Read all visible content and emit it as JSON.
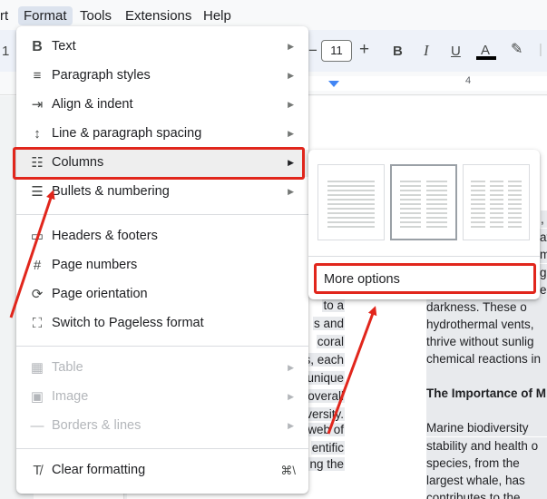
{
  "menubar": {
    "items": [
      "rt",
      "Format",
      "Tools",
      "Extensions",
      "Help"
    ]
  },
  "toolbar": {
    "minus": "−",
    "font_size": "11",
    "plus": "+",
    "bold": "B",
    "italic": "I",
    "underline": "U",
    "text_color": "A",
    "highlight": "✎",
    "more": "|",
    "left_cut": "1"
  },
  "ruler": {
    "number": "4"
  },
  "format_menu": {
    "items": [
      {
        "label": "Text",
        "icon": "bold-icon",
        "glyph": "B",
        "arrow": "▶"
      },
      {
        "label": "Paragraph styles",
        "icon": "paragraph-styles-icon",
        "glyph": "≡",
        "arrow": "▶"
      },
      {
        "label": "Align & indent",
        "icon": "align-indent-icon",
        "glyph": "⇥",
        "arrow": "▶"
      },
      {
        "label": "Line & paragraph spacing",
        "icon": "line-spacing-icon",
        "glyph": "↕",
        "arrow": "▶"
      },
      {
        "label": "Columns",
        "icon": "columns-icon",
        "glyph": "☷",
        "arrow": "▶"
      },
      {
        "label": "Bullets & numbering",
        "icon": "bulleted-list-icon",
        "glyph": "☰",
        "arrow": "▶"
      },
      {
        "label": "Headers & footers",
        "icon": "headers-footers-icon",
        "glyph": "▭"
      },
      {
        "label": "Page numbers",
        "icon": "hashtag-icon",
        "glyph": "#"
      },
      {
        "label": "Page orientation",
        "icon": "page-orientation-icon",
        "glyph": "⟳"
      },
      {
        "label": "Switch to Pageless format",
        "icon": "pageless-icon",
        "glyph": "⛶"
      },
      {
        "label": "Table",
        "icon": "table-icon",
        "glyph": "▦",
        "arrow": "▶"
      },
      {
        "label": "Image",
        "icon": "image-icon",
        "glyph": "▣",
        "arrow": "▶"
      },
      {
        "label": "Borders & lines",
        "icon": "borders-lines-icon",
        "glyph": "—",
        "arrow": "▶"
      },
      {
        "label": "Clear formatting",
        "icon": "clear-formatting-icon",
        "glyph": "T̸",
        "shortcut": "⌘\\"
      }
    ]
  },
  "columns_submenu": {
    "more_options": "More options"
  },
  "document": {
    "col1_lines": [
      "to a",
      "s and",
      "coral",
      "s, each",
      "unique",
      "overall",
      "versity.",
      "web of",
      "entific",
      "ng the"
    ],
    "col2_lines": [
      ",",
      "avi",
      "mi",
      "g",
      "e",
      "darkness.  These  o",
      "hydrothermal  vents,",
      "thrive  without  sunlig",
      "chemical reactions in",
      "",
      "The Importance of M",
      "",
      "Marine  biodiversity",
      "stability and health o",
      "species,  from  the",
      "largest  whale,  has",
      "contributes  to  the"
    ]
  },
  "colors": {
    "annotation_red": "#e1261c",
    "menu_highlight": "#eeeeee"
  }
}
